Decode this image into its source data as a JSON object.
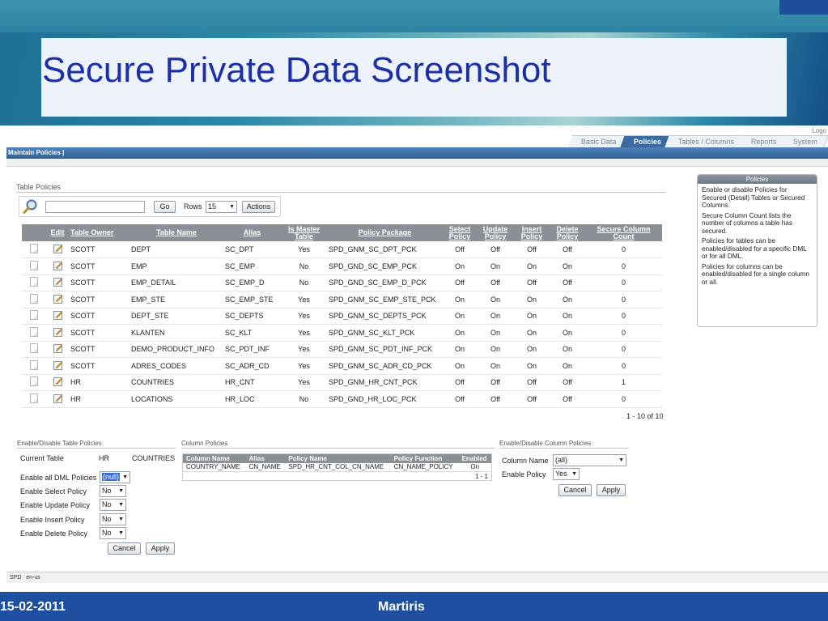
{
  "slide": {
    "title": "Secure Private Data Screenshot",
    "footer_date": "15-02-2011",
    "footer_author": "Martiris"
  },
  "app": {
    "logout": "Logo",
    "tabs": [
      "Basic Data",
      "Policies",
      "Tables / Columns",
      "Reports",
      "System"
    ],
    "active_tab": "Policies",
    "breadcrumb": "Maintain Policies |",
    "status_left": "SPD",
    "status_lang": "en-us"
  },
  "table_policies": {
    "title": "Table Policies",
    "search_value": "",
    "go_label": "Go",
    "rows_label": "Rows",
    "rows_value": "15",
    "actions_label": "Actions",
    "columns": [
      "",
      "Edit",
      "Table Owner",
      "Table Name",
      "Alias",
      "Is Master Table",
      "Policy Package",
      "Select Policy",
      "Update Policy",
      "Insert Policy",
      "Delete Policy",
      "Secure Column Count"
    ],
    "rows": [
      {
        "owner": "SCOTT",
        "table": "DEPT",
        "alias": "SC_DPT",
        "master": "Yes",
        "package": "SPD_GNM_SC_DPT_PCK",
        "select": "Off",
        "update": "Off",
        "insert": "Off",
        "delete": "Off",
        "count": "0"
      },
      {
        "owner": "SCOTT",
        "table": "EMP",
        "alias": "SC_EMP",
        "master": "No",
        "package": "SPD_GND_SC_EMP_PCK",
        "select": "On",
        "update": "On",
        "insert": "On",
        "delete": "On",
        "count": "0"
      },
      {
        "owner": "SCOTT",
        "table": "EMP_DETAIL",
        "alias": "SC_EMP_D",
        "master": "No",
        "package": "SPD_GND_SC_EMP_D_PCK",
        "select": "Off",
        "update": "Off",
        "insert": "Off",
        "delete": "Off",
        "count": "0"
      },
      {
        "owner": "SCOTT",
        "table": "EMP_STE",
        "alias": "SC_EMP_STE",
        "master": "Yes",
        "package": "SPD_GNM_SC_EMP_STE_PCK",
        "select": "On",
        "update": "On",
        "insert": "On",
        "delete": "On",
        "count": "0"
      },
      {
        "owner": "SCOTT",
        "table": "DEPT_STE",
        "alias": "SC_DEPTS",
        "master": "Yes",
        "package": "SPD_GNM_SC_DEPTS_PCK",
        "select": "On",
        "update": "On",
        "insert": "On",
        "delete": "On",
        "count": "0"
      },
      {
        "owner": "SCOTT",
        "table": "KLANTEN",
        "alias": "SC_KLT",
        "master": "Yes",
        "package": "SPD_GNM_SC_KLT_PCK",
        "select": "On",
        "update": "On",
        "insert": "On",
        "delete": "On",
        "count": "0"
      },
      {
        "owner": "SCOTT",
        "table": "DEMO_PRODUCT_INFO",
        "alias": "SC_PDT_INF",
        "master": "Yes",
        "package": "SPD_GNM_SC_PDT_INF_PCK",
        "select": "On",
        "update": "On",
        "insert": "On",
        "delete": "On",
        "count": "0"
      },
      {
        "owner": "SCOTT",
        "table": "ADRES_CODES",
        "alias": "SC_ADR_CD",
        "master": "Yes",
        "package": "SPD_GNM_SC_ADR_CD_PCK",
        "select": "On",
        "update": "On",
        "insert": "On",
        "delete": "On",
        "count": "0"
      },
      {
        "owner": "HR",
        "table": "COUNTRIES",
        "alias": "HR_CNT",
        "master": "Yes",
        "package": "SPD_GNM_HR_CNT_PCK",
        "select": "Off",
        "update": "Off",
        "insert": "Off",
        "delete": "Off",
        "count": "1"
      },
      {
        "owner": "HR",
        "table": "LOCATIONS",
        "alias": "HR_LOC",
        "master": "No",
        "package": "SPD_GND_HR_LOC_PCK",
        "select": "Off",
        "update": "Off",
        "insert": "Off",
        "delete": "Off",
        "count": "0"
      }
    ],
    "pagination": "1 - 10 of 10"
  },
  "help": {
    "title": "Policies",
    "paragraphs": [
      "Enable or disable Policies for Secured (Detail) Tables or Secured Columns.",
      "Secure Column Count lists the number of columns a table has secured.",
      "Policies for tables can be enabled/disabled for a specific DML or for all DML.",
      "Policies for columns can be enabled/disabled for a single column or all."
    ]
  },
  "enable_table": {
    "title": "Enable/Disable Table Policies",
    "current_table_label": "Current Table",
    "current_owner": "HR",
    "current_table": "COUNTRIES",
    "all_dml_label": "Enable all DML Policies",
    "all_dml_value": "(null)",
    "select_label": "Enable Select Policy",
    "select_value": "No",
    "update_label": "Enable Update Policy",
    "update_value": "No",
    "insert_label": "Enable Insert Policy",
    "insert_value": "No",
    "delete_label": "Enable Delete Policy",
    "delete_value": "No",
    "cancel_label": "Cancel",
    "apply_label": "Apply"
  },
  "column_policies": {
    "title": "Column Policies",
    "columns": [
      "Column Name",
      "Alias",
      "Policy Name",
      "Policy Function",
      "Enabled"
    ],
    "row": {
      "column": "COUNTRY_NAME",
      "alias": "CN_NAME",
      "policy": "SPD_HR_CNT_COL_CN_NAME",
      "function": "CN_NAME_POLICY",
      "enabled": "On"
    },
    "pagination": "1 - 1"
  },
  "enable_column": {
    "title": "Enable/Disable Column Policies",
    "column_name_label": "Column Name",
    "column_name_value": "(all)",
    "enable_label": "Enable Policy",
    "enable_value": "Yes",
    "cancel_label": "Cancel",
    "apply_label": "Apply"
  }
}
